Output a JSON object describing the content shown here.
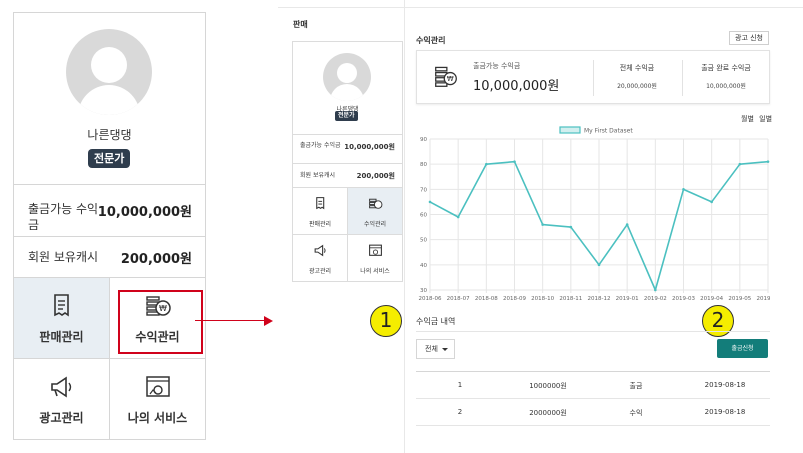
{
  "zoom": {
    "username": "나른댕댕",
    "badge": "전문가",
    "withdrawable_label": "출금가능 수익금",
    "withdrawable_value": "10,000,000원",
    "cash_label": "회원 보유캐시",
    "cash_value": "200,000원",
    "menu": [
      "판매관리",
      "수익관리",
      "광고관리",
      "나의 서비스"
    ]
  },
  "page": {
    "section_title": "판매",
    "username": "나른댕댕",
    "badge": "전문가",
    "withdrawable_label": "출금가능 수익금",
    "withdrawable_value": "10,000,000원",
    "cash_label": "회원 보유캐시",
    "cash_value": "200,000원",
    "menu": [
      "판매관리",
      "수익관리",
      "광고관리",
      "나의 서비스"
    ]
  },
  "revenue": {
    "title": "수익관리",
    "ad_button": "광고 신청",
    "summary": {
      "withdrawable_label": "출금가능 수익금",
      "withdrawable_value": "10,000,000원",
      "total_label": "전체 수익금",
      "total_value": "20,000,000원",
      "done_label": "출금 완료 수익금",
      "done_value": "10,000,000원"
    },
    "period_tabs": [
      "월별",
      "일별"
    ]
  },
  "chart_data": {
    "type": "line",
    "legend": "My First Dataset",
    "x": [
      "2018-06",
      "2018-07",
      "2018-08",
      "2018-09",
      "2018-10",
      "2018-11",
      "2018-12",
      "2019-01",
      "2019-02",
      "2019-03",
      "2019-04",
      "2019-05",
      "2019-06"
    ],
    "values": [
      65,
      59,
      80,
      81,
      56,
      55,
      40,
      56,
      30,
      70,
      65,
      80,
      81
    ],
    "ylim": [
      30,
      90
    ],
    "yticks": [
      30,
      40,
      50,
      60,
      70,
      80,
      90
    ],
    "color": "#4bc0c0",
    "grid": true,
    "legend_position": "top"
  },
  "markers": [
    "1",
    "2"
  ],
  "history": {
    "title": "수익금 내역",
    "filter_value": "전체",
    "withdraw_button": "출금신청",
    "rows": [
      [
        "1",
        "1000000원",
        "출금",
        "2019-08-18"
      ],
      [
        "2",
        "2000000원",
        "수익",
        "2019-08-18"
      ]
    ]
  }
}
